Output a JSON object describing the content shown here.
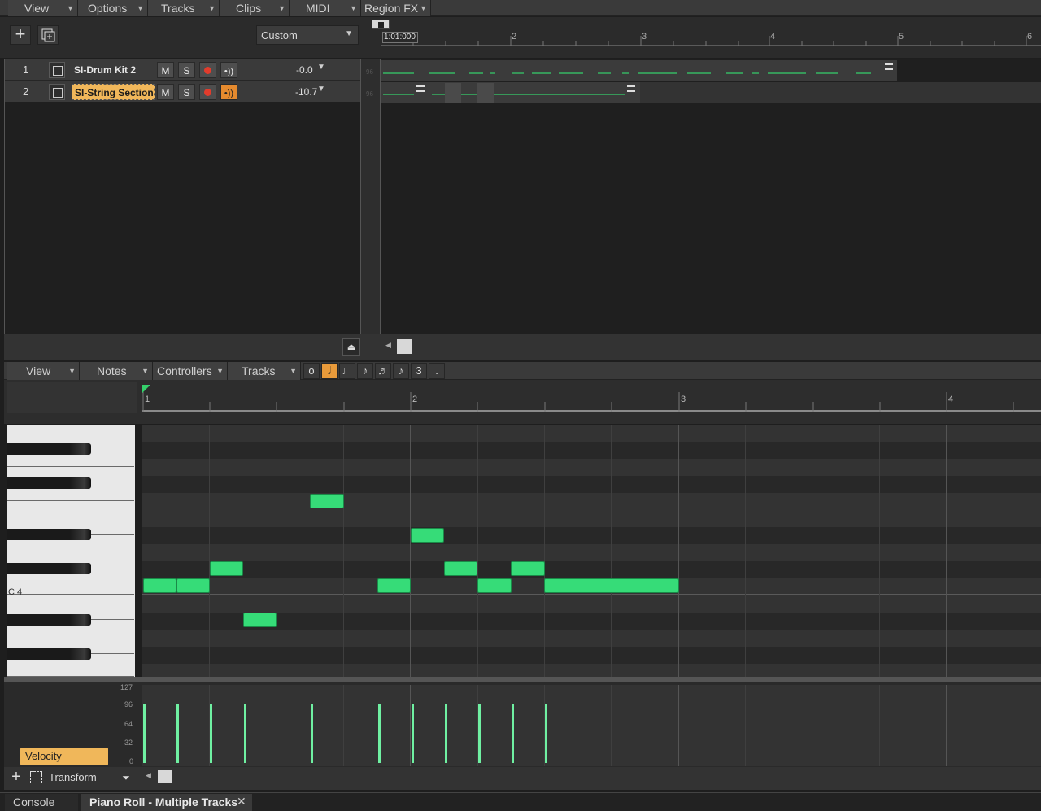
{
  "top_menu": [
    {
      "label": "View"
    },
    {
      "label": "Options"
    },
    {
      "label": "Tracks"
    },
    {
      "label": "Clips"
    },
    {
      "label": "MIDI"
    },
    {
      "label": "Region FX"
    }
  ],
  "toolbar": {
    "preset": "Custom"
  },
  "timeline": {
    "position": "1:01:000",
    "markers": [
      "2",
      "3",
      "4",
      "5",
      "6"
    ]
  },
  "tracks": [
    {
      "num": "1",
      "name": "SI-Drum Kit 2",
      "mute": "M",
      "solo": "S",
      "volume": "-0.0"
    },
    {
      "num": "2",
      "name": "SI-String Section",
      "mute": "M",
      "solo": "S",
      "volume": "-10.7"
    }
  ],
  "clip_values": {
    "row1": "96",
    "row2": "96"
  },
  "pr_menu": [
    {
      "label": "View"
    },
    {
      "label": "Notes"
    },
    {
      "label": "Controllers"
    },
    {
      "label": "Tracks"
    }
  ],
  "pr_tools": {
    "triplet": "3",
    "dot": "."
  },
  "pr_ruler": {
    "markers": [
      "1",
      "2",
      "3",
      "4"
    ]
  },
  "keyboard": {
    "c4_label": "C 4"
  },
  "velocity_axis": [
    "127",
    "96",
    "64",
    "32",
    "0"
  ],
  "velocity_pane": {
    "label": "Velocity",
    "transform": "Transform"
  },
  "notes": [
    {
      "start": 1.0,
      "length": 0.5,
      "pitch": "C4"
    },
    {
      "start": 1.5,
      "length": 0.5,
      "pitch": "C4"
    },
    {
      "start": 2.0,
      "length": 0.5,
      "pitch": "D4"
    },
    {
      "start": 2.5,
      "length": 0.5,
      "pitch": "A3"
    },
    {
      "start": 3.5,
      "length": 0.5,
      "pitch": "A4"
    },
    {
      "start": 4.5,
      "length": 0.5,
      "pitch": "C4"
    },
    {
      "start": 5.0,
      "length": 0.5,
      "pitch": "F4"
    },
    {
      "start": 5.5,
      "length": 0.5,
      "pitch": "D4"
    },
    {
      "start": 6.0,
      "length": 0.5,
      "pitch": "C4"
    },
    {
      "start": 6.5,
      "length": 0.5,
      "pitch": "D4"
    },
    {
      "start": 7.0,
      "length": 2.0,
      "pitch": "C4"
    }
  ],
  "tabs": [
    {
      "label": "Console"
    },
    {
      "label": "Piano Roll - Multiple Tracks"
    }
  ],
  "colors": {
    "note": "#36dc78",
    "selected_track": "#f0b75a",
    "accent": "#e58a2e"
  }
}
